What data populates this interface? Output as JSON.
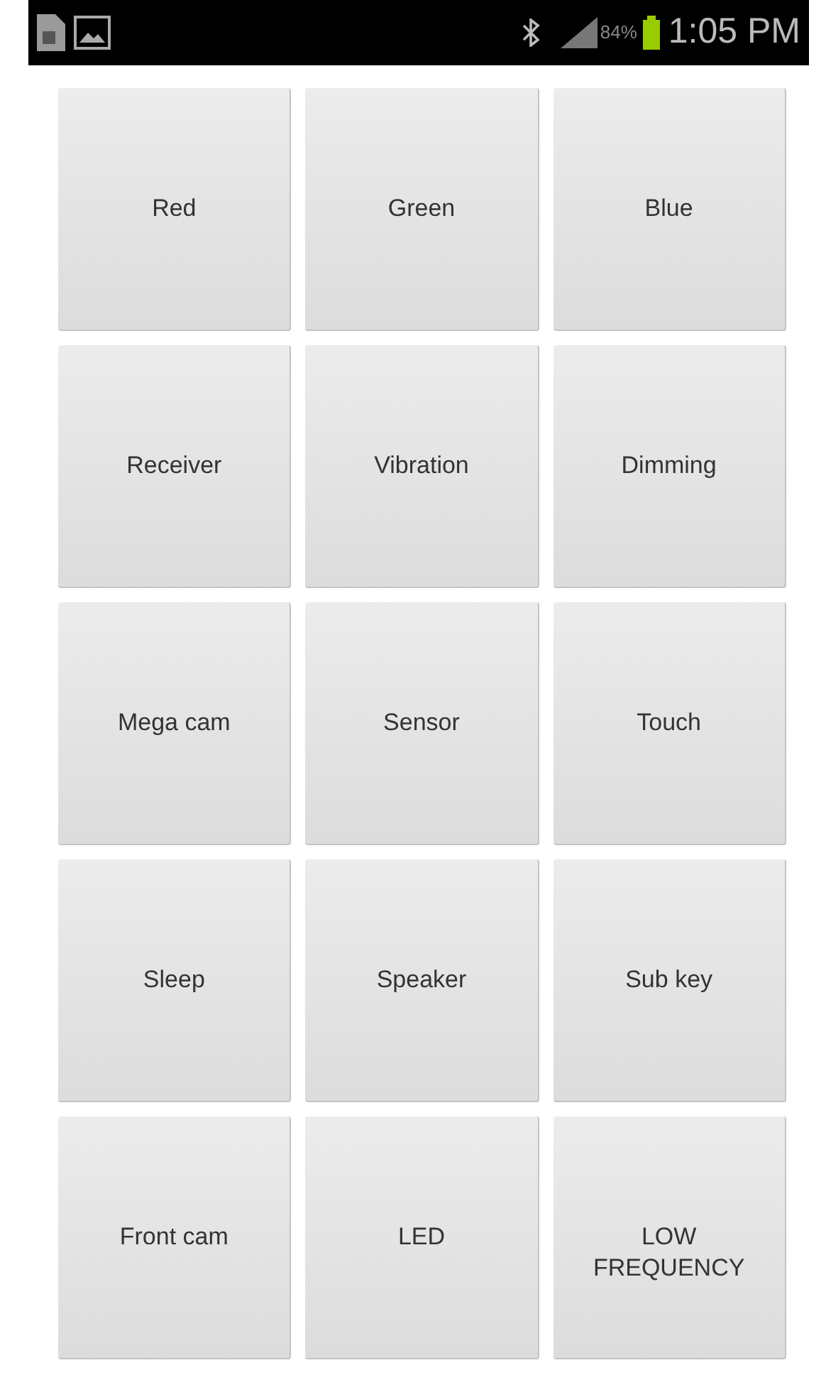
{
  "status_bar": {
    "battery_percent": "84%",
    "time": "1:05 PM"
  },
  "buttons": [
    "Red",
    "Green",
    "Blue",
    "Receiver",
    "Vibration",
    "Dimming",
    "Mega cam",
    "Sensor",
    "Touch",
    "Sleep",
    "Speaker",
    "Sub key",
    "Front cam",
    "LED",
    "LOW\nFREQUENCY"
  ]
}
